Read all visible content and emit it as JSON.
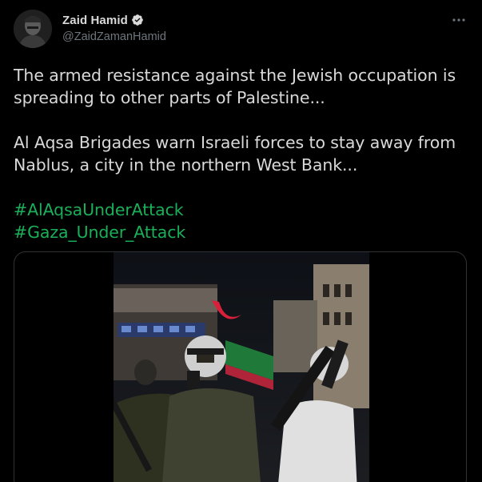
{
  "author": {
    "display_name": "Zaid Hamid",
    "handle": "@ZaidZamanHamid",
    "verified_icon": "verified-badge-icon"
  },
  "tweet": {
    "paragraph1_line1": "The armed resistance against the Jewish occupation is",
    "paragraph1_line2": "spreading to other parts of Palestine...",
    "paragraph2_line1": "Al Aqsa Brigades warn Israeli forces to stay away from",
    "paragraph2_line2": "Nablus, a city in the northern West Bank...",
    "hashtags": [
      "#AlAqsaUnderAttack",
      "#Gaza_Under_Attack"
    ]
  },
  "menu": {
    "more_icon": "more-options-icon"
  },
  "colors": {
    "background": "#000000",
    "text": "#d9d9d9",
    "secondary_text": "#6e767d",
    "hashtag": "#1ab059",
    "verified": "#d9d9d9",
    "border": "#2f3336"
  }
}
